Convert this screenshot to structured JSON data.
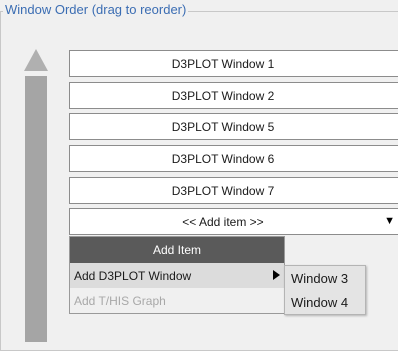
{
  "group": {
    "title": "Window Order (drag to reorder)"
  },
  "window_list": [
    {
      "label": "D3PLOT Window 1"
    },
    {
      "label": "D3PLOT Window 2"
    },
    {
      "label": "D3PLOT Window 5"
    },
    {
      "label": "D3PLOT Window 6"
    },
    {
      "label": "D3PLOT Window 7"
    }
  ],
  "add_select": {
    "label": "<< Add item >>",
    "icon": "triangle-down-icon"
  },
  "menu": {
    "header": "Add Item",
    "items": [
      {
        "label": "Add D3PLOT Window",
        "has_submenu": true,
        "state": "active"
      },
      {
        "label": "Add T/HIS Graph",
        "state": "disabled"
      }
    ]
  },
  "submenu": {
    "items": [
      {
        "label": "Window 3"
      },
      {
        "label": "Window 4"
      }
    ]
  },
  "scrollbar": {
    "up_icon": "triangle-up-icon"
  }
}
